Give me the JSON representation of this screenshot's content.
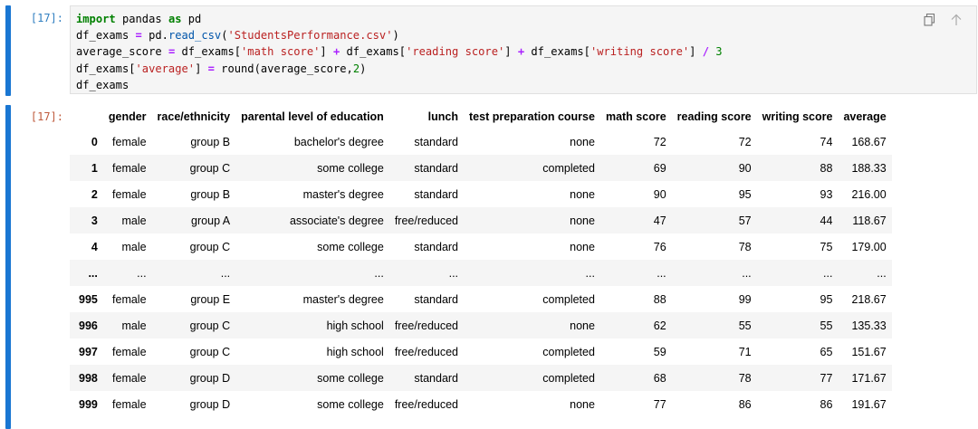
{
  "input_cell": {
    "prompt": "[17]:",
    "code_lines": [
      [
        {
          "t": "import",
          "c": "kw"
        },
        {
          "t": " pandas "
        },
        {
          "t": "as",
          "c": "kw"
        },
        {
          "t": " pd"
        }
      ],
      [
        {
          "t": "df_exams "
        },
        {
          "t": "=",
          "c": "op"
        },
        {
          "t": " pd."
        },
        {
          "t": "read_csv",
          "c": "fn"
        },
        {
          "t": "("
        },
        {
          "t": "'StudentsPerformance.csv'",
          "c": "str"
        },
        {
          "t": ")"
        }
      ],
      [
        {
          "t": "average_score "
        },
        {
          "t": "=",
          "c": "op"
        },
        {
          "t": " df_exams["
        },
        {
          "t": "'math score'",
          "c": "str"
        },
        {
          "t": "] "
        },
        {
          "t": "+",
          "c": "op"
        },
        {
          "t": " df_exams["
        },
        {
          "t": "'reading score'",
          "c": "str"
        },
        {
          "t": "] "
        },
        {
          "t": "+",
          "c": "op"
        },
        {
          "t": " df_exams["
        },
        {
          "t": "'writing score'",
          "c": "str"
        },
        {
          "t": "] "
        },
        {
          "t": "/",
          "c": "op"
        },
        {
          "t": " "
        },
        {
          "t": "3",
          "c": "num"
        }
      ],
      [
        {
          "t": "df_exams["
        },
        {
          "t": "'average'",
          "c": "str"
        },
        {
          "t": "] "
        },
        {
          "t": "=",
          "c": "op"
        },
        {
          "t": " round(average_score,"
        },
        {
          "t": "2",
          "c": "num"
        },
        {
          "t": ")"
        }
      ],
      [
        {
          "t": "df_exams"
        }
      ]
    ],
    "toolbar_icons": [
      "copy-icon",
      "move-up-icon"
    ]
  },
  "output_cell": {
    "prompt": "[17]:",
    "columns": [
      "",
      "gender",
      "race/ethnicity",
      "parental level of education",
      "lunch",
      "test preparation course",
      "math score",
      "reading score",
      "writing score",
      "average"
    ],
    "rows": [
      [
        "0",
        "female",
        "group B",
        "bachelor's degree",
        "standard",
        "none",
        "72",
        "72",
        "74",
        "168.67"
      ],
      [
        "1",
        "female",
        "group C",
        "some college",
        "standard",
        "completed",
        "69",
        "90",
        "88",
        "188.33"
      ],
      [
        "2",
        "female",
        "group B",
        "master's degree",
        "standard",
        "none",
        "90",
        "95",
        "93",
        "216.00"
      ],
      [
        "3",
        "male",
        "group A",
        "associate's degree",
        "free/reduced",
        "none",
        "47",
        "57",
        "44",
        "118.67"
      ],
      [
        "4",
        "male",
        "group C",
        "some college",
        "standard",
        "none",
        "76",
        "78",
        "75",
        "179.00"
      ],
      [
        "...",
        "...",
        "...",
        "...",
        "...",
        "...",
        "...",
        "...",
        "...",
        "..."
      ],
      [
        "995",
        "female",
        "group E",
        "master's degree",
        "standard",
        "completed",
        "88",
        "99",
        "95",
        "218.67"
      ],
      [
        "996",
        "male",
        "group C",
        "high school",
        "free/reduced",
        "none",
        "62",
        "55",
        "55",
        "135.33"
      ],
      [
        "997",
        "female",
        "group C",
        "high school",
        "free/reduced",
        "completed",
        "59",
        "71",
        "65",
        "151.67"
      ],
      [
        "998",
        "female",
        "group D",
        "some college",
        "standard",
        "completed",
        "68",
        "78",
        "77",
        "171.67"
      ],
      [
        "999",
        "female",
        "group D",
        "some college",
        "free/reduced",
        "none",
        "77",
        "86",
        "86",
        "191.67"
      ]
    ]
  },
  "colors": {
    "cell_bar": "#1976d2",
    "prompt_in": "#307fc1",
    "prompt_out": "#bf5b3d",
    "keyword": "#008000",
    "string": "#ba2121",
    "operator": "#aa22ff"
  }
}
